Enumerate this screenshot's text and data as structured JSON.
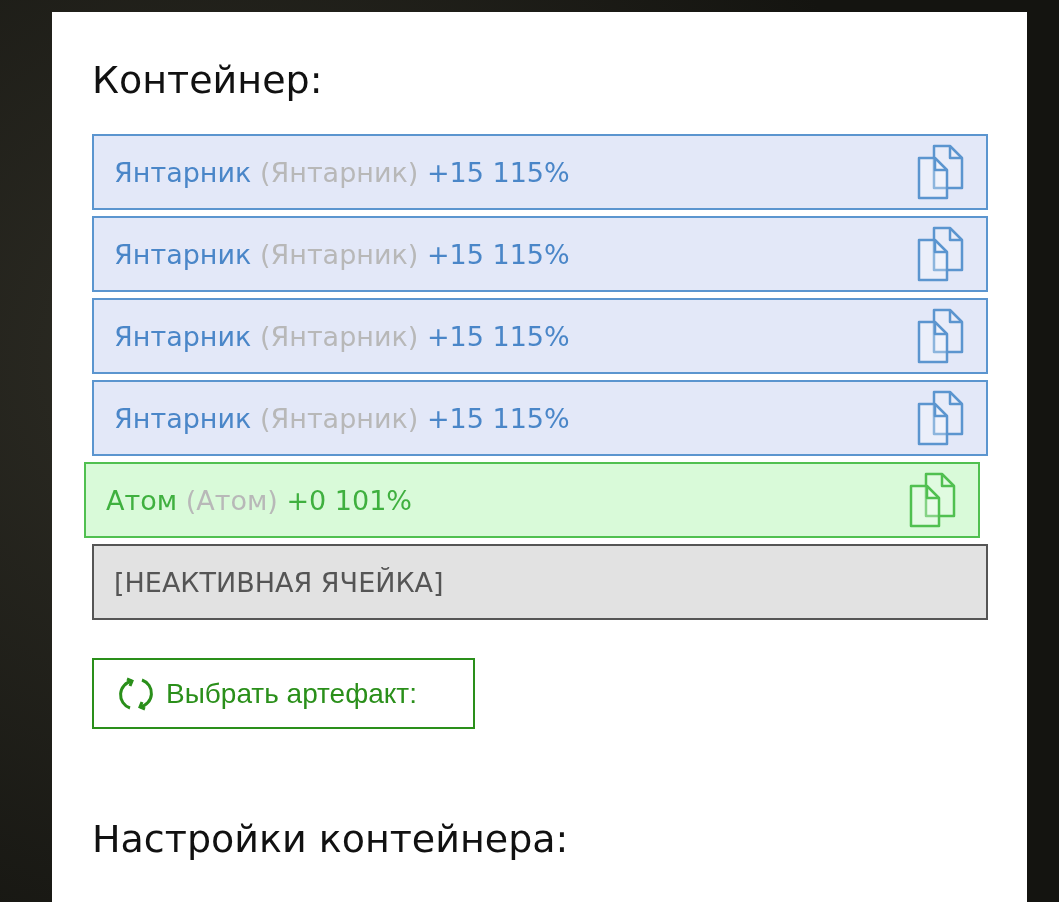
{
  "container": {
    "title": "Контейнер:",
    "slots": [
      {
        "kind": "normal",
        "name": "Янтарник",
        "alias": "(Янтарник)",
        "bonus": "+15 115%"
      },
      {
        "kind": "normal",
        "name": "Янтарник",
        "alias": "(Янтарник)",
        "bonus": "+15 115%"
      },
      {
        "kind": "normal",
        "name": "Янтарник",
        "alias": "(Янтарник)",
        "bonus": "+15 115%"
      },
      {
        "kind": "normal",
        "name": "Янтарник",
        "alias": "(Янтарник)",
        "bonus": "+15 115%"
      },
      {
        "kind": "highlighted",
        "name": "Атом",
        "alias": "(Атом)",
        "bonus": "+0 101%"
      },
      {
        "kind": "inactive",
        "name": "[НЕАКТИВНАЯ ЯЧЕЙКА]"
      }
    ],
    "select_button": "Выбрать артефакт:"
  },
  "settings": {
    "title": "Настройки контейнера:"
  }
}
